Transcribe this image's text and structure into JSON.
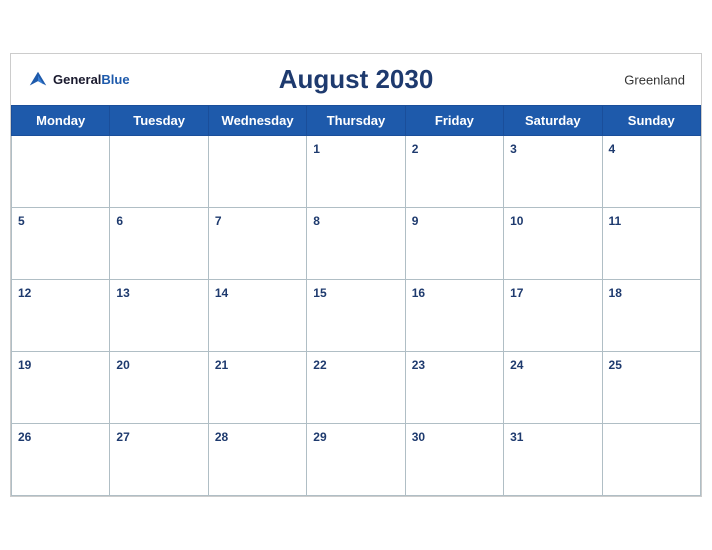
{
  "calendar": {
    "title": "August 2030",
    "region": "Greenland",
    "logo": {
      "general": "General",
      "blue": "Blue"
    },
    "weekdays": [
      "Monday",
      "Tuesday",
      "Wednesday",
      "Thursday",
      "Friday",
      "Saturday",
      "Sunday"
    ],
    "weeks": [
      [
        null,
        null,
        null,
        1,
        2,
        3,
        4
      ],
      [
        5,
        6,
        7,
        8,
        9,
        10,
        11
      ],
      [
        12,
        13,
        14,
        15,
        16,
        17,
        18
      ],
      [
        19,
        20,
        21,
        22,
        23,
        24,
        25
      ],
      [
        26,
        27,
        28,
        29,
        30,
        31,
        null
      ]
    ]
  }
}
